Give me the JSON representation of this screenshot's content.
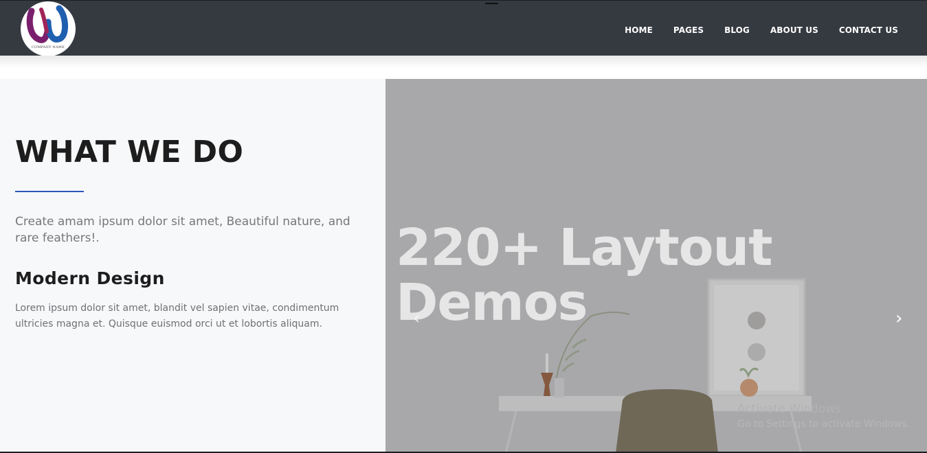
{
  "header": {
    "logo_text": "COMPANY NAME",
    "nav": [
      {
        "label": "HOME"
      },
      {
        "label": "PAGES"
      },
      {
        "label": "BLOG"
      },
      {
        "label": "ABOUT US"
      },
      {
        "label": "CONTACT US"
      }
    ]
  },
  "content": {
    "title": "WHAT WE DO",
    "lead": "Create amam ipsum dolor sit amet, Beautiful nature, and rare feathers!.",
    "subhead": "Modern Design",
    "body": "Lorem ipsum dolor sit amet, blandit vel sapien vitae, condimentum ultricies magna et. Quisque euismod orci ut et lobortis aliquam."
  },
  "hero": {
    "title_line1": "220+ Laytout",
    "title_line2": "Demos",
    "prev_icon": "chevron-left-icon",
    "next_icon": "chevron-right-icon"
  },
  "watermark": {
    "line1": "Activate Windows",
    "line2": "Go to Settings to activate Windows."
  },
  "colors": {
    "topbar": "#353940",
    "accent": "#2b56b8",
    "left_panel": "#f7f8fa",
    "hero_overlay": "#a7a7a9"
  }
}
